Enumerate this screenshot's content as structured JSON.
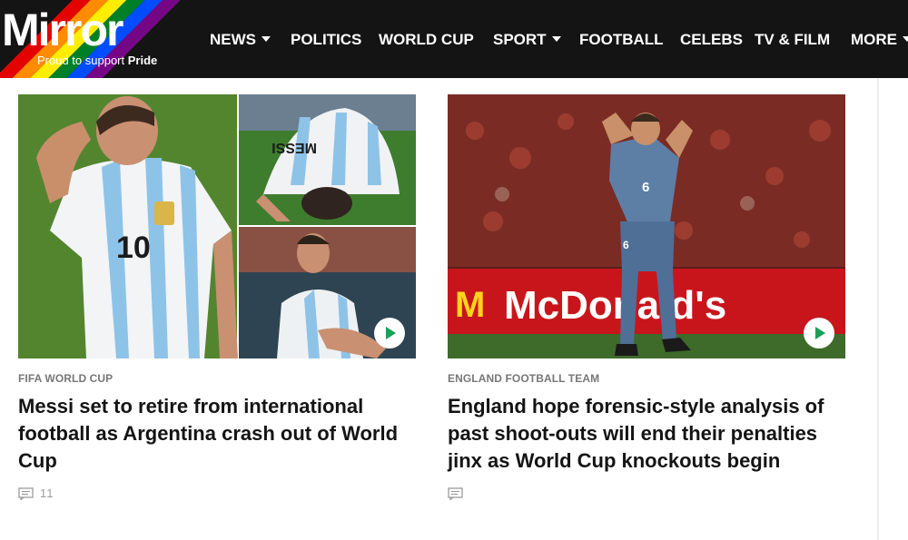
{
  "header": {
    "logo_word": "Mirror",
    "logo_tagline_prefix": "Proud to support ",
    "logo_tagline_bold": "Pride",
    "nav": [
      {
        "label": "NEWS",
        "dropdown": true
      },
      {
        "label": "POLITICS",
        "dropdown": false
      },
      {
        "label": "WORLD CUP",
        "dropdown": false
      },
      {
        "label": "SPORT",
        "dropdown": true
      },
      {
        "label": "FOOTBALL",
        "dropdown": false
      },
      {
        "label": "CELEBS",
        "dropdown": false
      },
      {
        "label": "TV & FILM",
        "dropdown": false
      },
      {
        "label": "MORE",
        "dropdown": true
      }
    ]
  },
  "articles": [
    {
      "kicker": "FIFA WORLD CUP",
      "headline": "Messi set to retire from international football as Argentina crash out of World Cup",
      "comment_count": "11",
      "has_video": true,
      "jersey_text": "MESSI",
      "jersey_number": "10"
    },
    {
      "kicker": "ENGLAND FOOTBALL TEAM",
      "headline": "England hope forensic-style analysis of past shoot-outs will end their penalties jinx as World Cup knockouts begin",
      "comment_count": "",
      "has_video": true,
      "board_text": "McDonald's",
      "shirt_number": "6"
    }
  ],
  "colors": {
    "header_bg": "#141414",
    "video_play": "#18a058",
    "kicker": "#777777",
    "headline": "#141414"
  }
}
